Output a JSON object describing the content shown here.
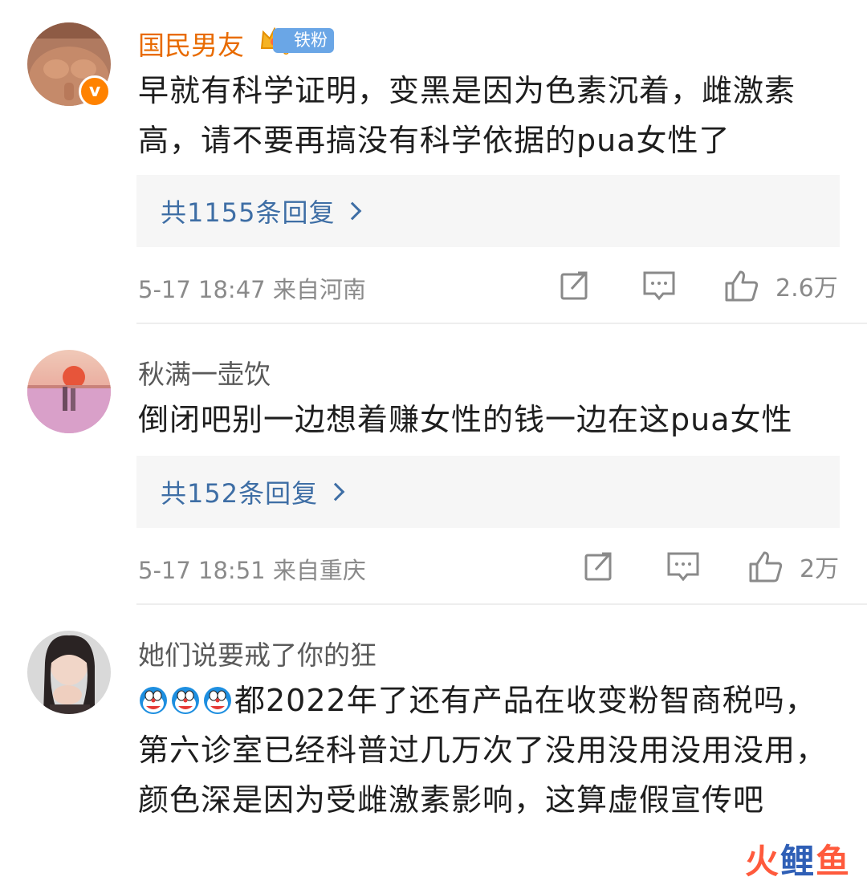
{
  "comments": [
    {
      "username": "国民男友",
      "fan_badge": "铁粉",
      "text": "早就有科学证明，变黑是因为色素沉着，雌激素高，请不要再搞没有科学依据的pua女性了",
      "replies": "共1155条回复",
      "time_location": "5-17 18:47  来自河南",
      "likes": "2.6万"
    },
    {
      "username": "秋满一壶饮",
      "text": "倒闭吧别一边想着赚女性的钱一边在这pua女性",
      "replies": "共152条回复",
      "time_location": "5-17 18:51  来自重庆",
      "likes": "2万"
    },
    {
      "username": "她们说要戒了你的狂",
      "text": "都2022年了还有产品在收变粉智商税吗，第六诊室已经科普过几万次了没用没用没用没用，颜色深是因为受雌激素影响，这算虚假宣传吧"
    }
  ],
  "icons": {
    "verified": "v-badge-icon",
    "repost": "repost-icon",
    "comment": "comment-icon",
    "like": "like-icon",
    "emoji": "doraemon-emoji-icon"
  },
  "watermark": {
    "part1": "火",
    "part2": "鲤",
    "part3": "鱼"
  },
  "colors": {
    "username_gold": "#e86b00",
    "reply_link": "#3e6ea5",
    "fan_badge": "#6aa6e6",
    "vip_orange": "#ff8200"
  }
}
